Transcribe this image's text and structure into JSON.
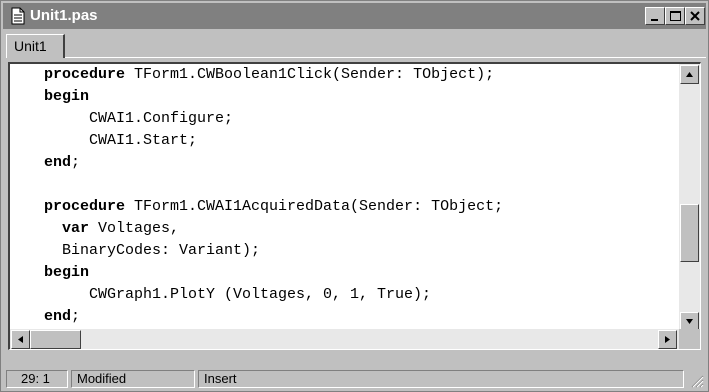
{
  "window": {
    "title": "Unit1.pas",
    "active_tab": "Unit1"
  },
  "code_lines": [
    {
      "kw": "procedure",
      "rest": " TForm1.CWBoolean1Click(Sender: TObject);"
    },
    {
      "kw": "begin",
      "rest": ""
    },
    {
      "kw": "",
      "rest": "     CWAI1.Configure;"
    },
    {
      "kw": "",
      "rest": "     CWAI1.Start;"
    },
    {
      "kw": "end",
      "rest": ";"
    },
    {
      "kw": "",
      "rest": ""
    },
    {
      "kw": "procedure",
      "rest": " TForm1.CWAI1AcquiredData(Sender: TObject;"
    },
    {
      "kw": "  var",
      "rest": " Voltages,"
    },
    {
      "kw": "",
      "rest": "  BinaryCodes: Variant);"
    },
    {
      "kw": "begin",
      "rest": ""
    },
    {
      "kw": "",
      "rest": "     CWGraph1.PlotY (Voltages, 0, 1, True);"
    },
    {
      "kw": "end",
      "rest": ";"
    }
  ],
  "statusbar": {
    "position": "29:  1",
    "modified": "Modified",
    "mode": "Insert"
  },
  "icons": {
    "title": "document-icon",
    "minimize": "minimize-icon",
    "maximize": "maximize-icon",
    "close": "close-icon"
  },
  "colors": {
    "titlebar_inactive": "#808080",
    "face": "#c0c0c0",
    "editor_bg": "#ffffff"
  }
}
